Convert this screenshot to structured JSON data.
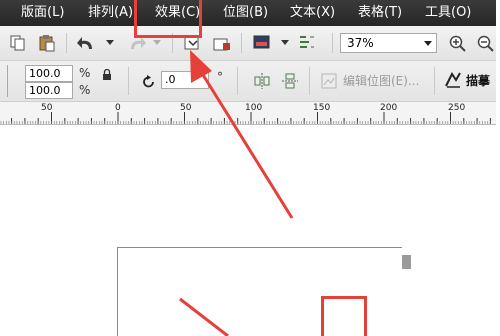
{
  "menu": {
    "items": [
      "版面(L)",
      "排列(A)",
      "效果(C)",
      "位图(B)",
      "文本(X)",
      "表格(T)",
      "工具(O)"
    ],
    "highlighted": "效果(C)"
  },
  "toolbar": {
    "zoom_value": "37%"
  },
  "property_bar": {
    "scale_x": "100.0",
    "scale_y": "100.0",
    "percent_symbol": "%",
    "angle_value": ".0",
    "degree_symbol": "°",
    "edit_bitmap_label": "编辑位图(E)...",
    "trace_label": "描摹"
  },
  "ruler": {
    "labels": [
      "50",
      "0",
      "50",
      "100",
      "150",
      "200",
      "250"
    ]
  },
  "colors": {
    "menubar": "#2e2e2e",
    "annotation_red": "#e6403a"
  }
}
